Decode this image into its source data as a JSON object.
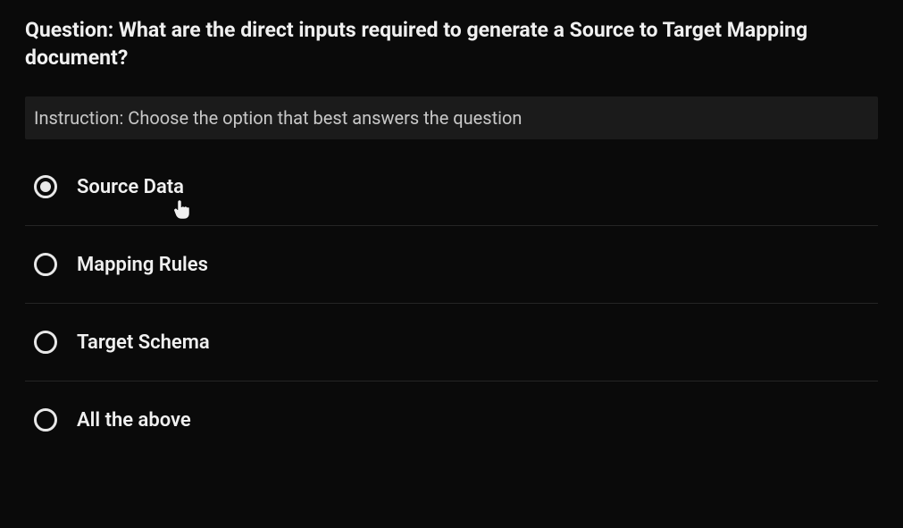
{
  "question": {
    "label_prefix": "Question: ",
    "text": "What are the direct inputs required to generate a Source to Target Mapping document?"
  },
  "instruction": {
    "label_prefix": "Instruction: ",
    "text": "Choose the option that best answers the question"
  },
  "options": [
    {
      "label": "Source Data",
      "selected": true
    },
    {
      "label": "Mapping Rules",
      "selected": false
    },
    {
      "label": "Target Schema",
      "selected": false
    },
    {
      "label": "All the above",
      "selected": false
    }
  ],
  "icons": {
    "cursor": "pointer-cursor"
  }
}
